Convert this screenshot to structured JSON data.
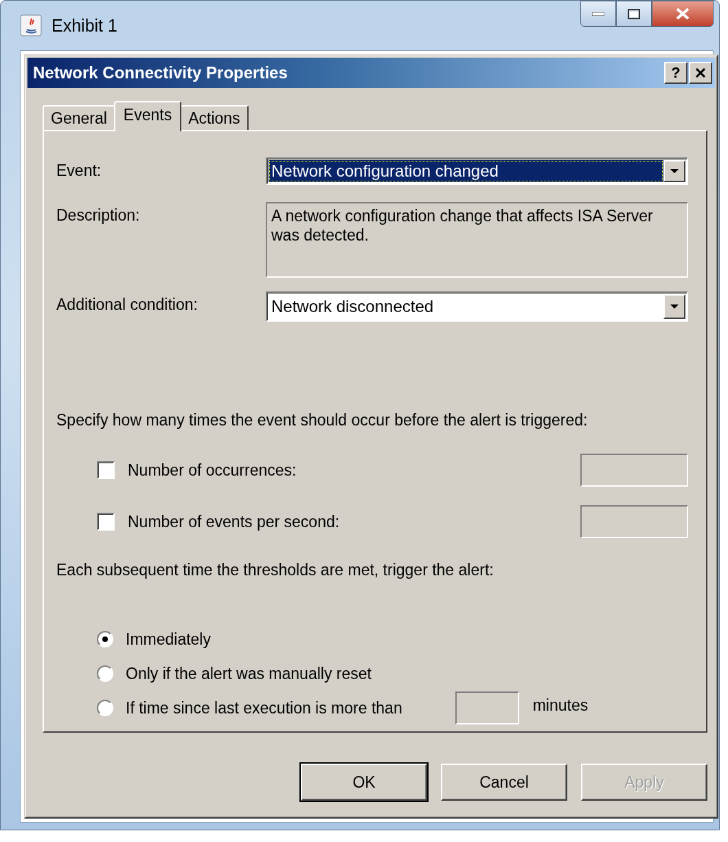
{
  "window": {
    "title": "Exhibit 1"
  },
  "dialog": {
    "title": "Network Connectivity Properties",
    "help_button": "?"
  },
  "tabs": [
    {
      "label": "General",
      "selected": false
    },
    {
      "label": "Events",
      "selected": true
    },
    {
      "label": "Actions",
      "selected": false
    }
  ],
  "event": {
    "label": "Event:",
    "value": "Network configuration changed",
    "focused": true
  },
  "description": {
    "label": "Description:",
    "text": "A network configuration change that affects ISA Server was detected."
  },
  "additional_condition": {
    "label": "Additional condition:",
    "value": "Network disconnected",
    "focused": false
  },
  "threshold_prompt": "Specify how many times the event should occur before the alert is triggered:",
  "thresholds": [
    {
      "label": "Number of occurrences:",
      "checked": false,
      "field_disabled": true
    },
    {
      "label": "Number of events per second:",
      "checked": false,
      "field_disabled": true
    }
  ],
  "repeat_prompt": "Each subsequent time the thresholds are met, trigger the alert:",
  "repeat_options": [
    {
      "label": "Immediately",
      "selected": true
    },
    {
      "label": "Only if the alert was manually reset",
      "selected": false
    },
    {
      "label": "If time since last execution is more than",
      "selected": false,
      "field_disabled": true,
      "unit": "minutes"
    }
  ],
  "buttons": [
    {
      "label": "OK",
      "default": true,
      "disabled": false
    },
    {
      "label": "Cancel",
      "default": false,
      "disabled": false
    },
    {
      "label": "Apply",
      "default": false,
      "disabled": true
    }
  ]
}
